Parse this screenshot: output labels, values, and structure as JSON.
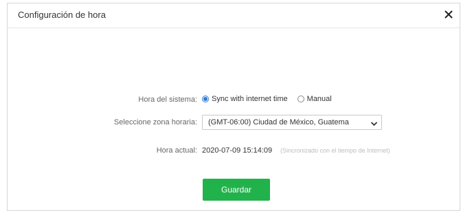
{
  "dialog": {
    "title": "Configuración de hora",
    "close_icon": "close-icon"
  },
  "system_time": {
    "label": "Hora del sistema:",
    "options": [
      {
        "label": "Sync with internet time",
        "selected": true
      },
      {
        "label": "Manual",
        "selected": false
      }
    ]
  },
  "timezone": {
    "label": "Seleccione zona horaria:",
    "selected_value": "(GMT-06:00) Ciudad de México, Guatema",
    "chevron_icon": "chevron-down-icon"
  },
  "current_time": {
    "label": "Hora actual:",
    "value": "2020-07-09 15:14:09",
    "note": "(Sincronizado con el tiempo de Internet)"
  },
  "actions": {
    "save_label": "Guardar"
  },
  "colors": {
    "accent": "#2f7bd8",
    "save_button": "#22b24c",
    "note_text": "#bdbdbd"
  }
}
